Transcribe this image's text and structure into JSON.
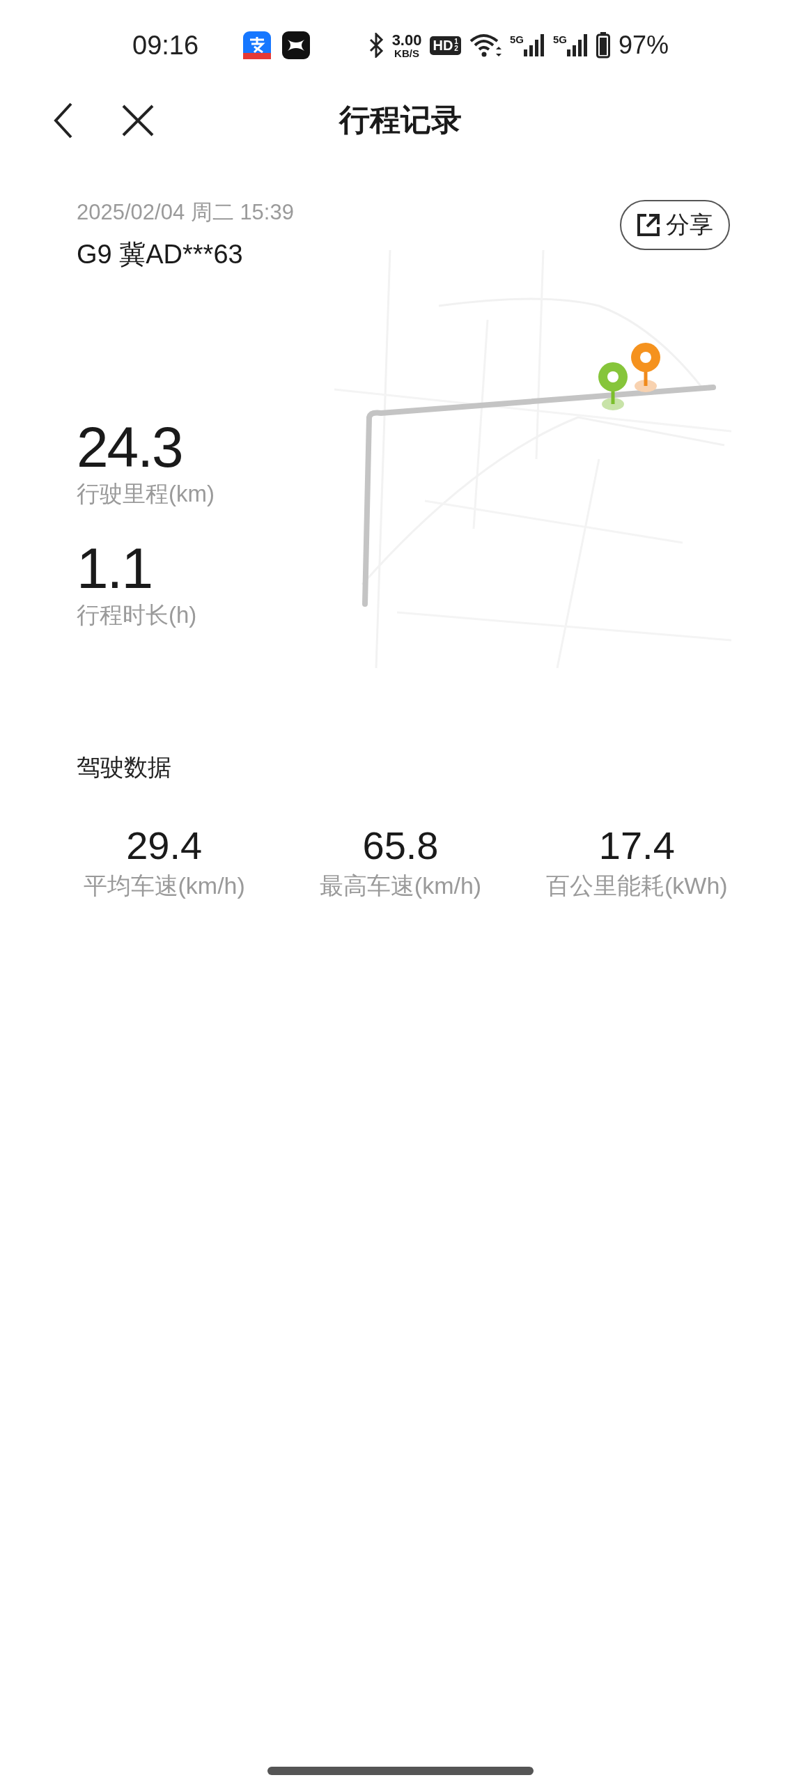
{
  "status_bar": {
    "time": "09:16",
    "net_speed": "3.00",
    "net_unit": "KB/S",
    "hd_badge": "HD",
    "hd_slots": [
      "1",
      "2"
    ],
    "sim_labels": [
      "5G",
      "5G"
    ],
    "battery": "97%"
  },
  "nav": {
    "title": "行程记录"
  },
  "trip": {
    "datetime": "2025/02/04 周二 15:39",
    "vehicle": "G9 冀AD***63",
    "share_label": "分享",
    "stats": [
      {
        "value": "24.3",
        "label": "行驶里程(km)"
      },
      {
        "value": "1.1",
        "label": "行程时长(h)"
      }
    ]
  },
  "driving": {
    "title": "驾驶数据",
    "metrics": [
      {
        "value": "29.4",
        "label": "平均车速(km/h)"
      },
      {
        "value": "65.8",
        "label": "最高车速(km/h)"
      },
      {
        "value": "17.4",
        "label": "百公里能耗(kWh)"
      }
    ]
  }
}
